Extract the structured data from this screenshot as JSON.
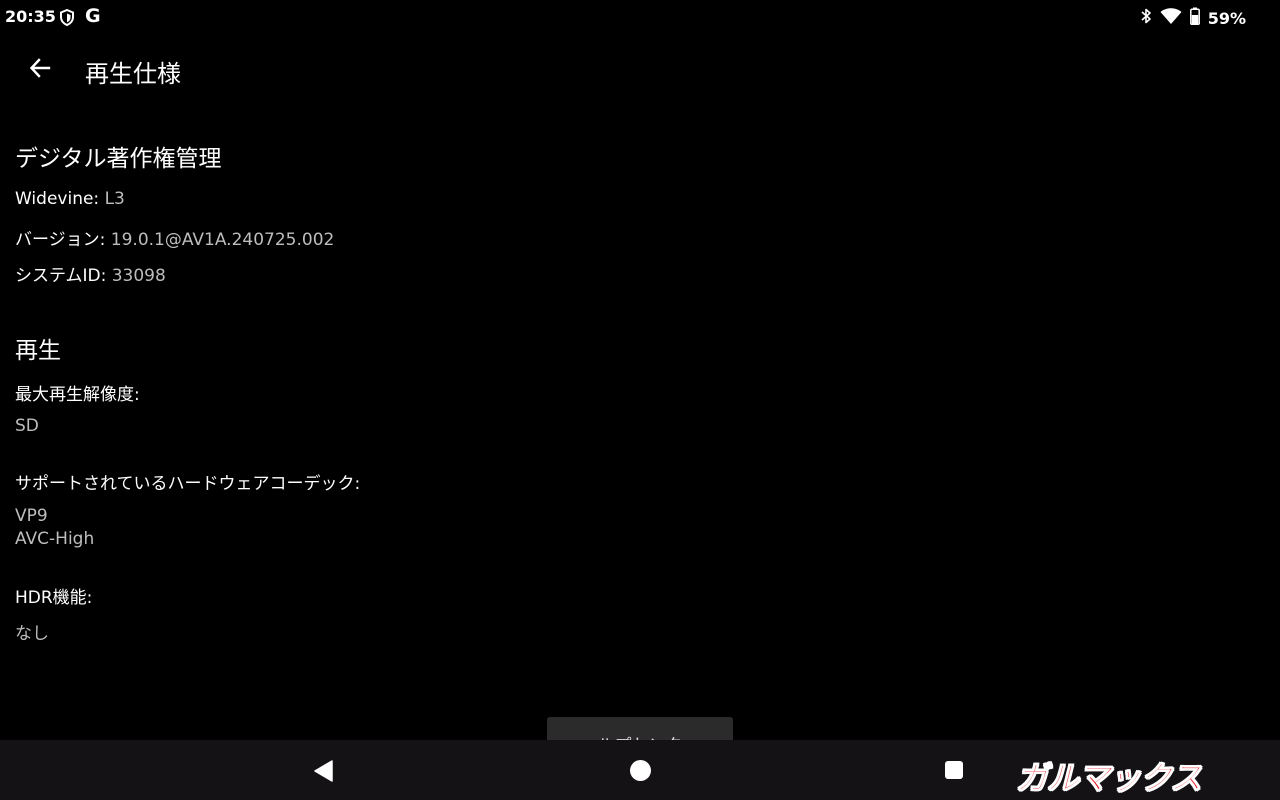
{
  "status_bar": {
    "time": "20:35",
    "g_icon_text": "G",
    "battery_percent": "59%",
    "icons": [
      "shield-icon",
      "google-icon",
      "bluetooth-icon",
      "wifi-icon",
      "battery-icon"
    ]
  },
  "app_bar": {
    "title": "再生仕様",
    "back_icon": "arrow-left-icon"
  },
  "drm": {
    "heading": "デジタル著作権管理",
    "widevine_label": "Widevine:",
    "widevine_value": "L3",
    "version_label": "バージョン:",
    "version_value": "19.0.1@AV1A.240725.002",
    "system_id_label": "システムID:",
    "system_id_value": "33098"
  },
  "playback": {
    "heading": "再生",
    "max_resolution_label": "最大再生解像度:",
    "max_resolution_value": "SD",
    "codecs_label": "サポートされているハードウェアコーデック:",
    "codecs": [
      "VP9",
      "AVC-High"
    ],
    "hdr_label": "HDR機能:",
    "hdr_value": "なし"
  },
  "help_center": {
    "label": "ヘルプセンター"
  },
  "nav_bar": {
    "icons": [
      "nav-back-icon",
      "nav-home-icon",
      "nav-recents-icon"
    ]
  },
  "watermark": {
    "text": "ガルマックス"
  },
  "colors": {
    "background": "#000000",
    "primary_text": "#ffffff",
    "secondary_text": "#bdbdbd",
    "nav_bar": "#141214",
    "watermark": "#e8141c"
  }
}
